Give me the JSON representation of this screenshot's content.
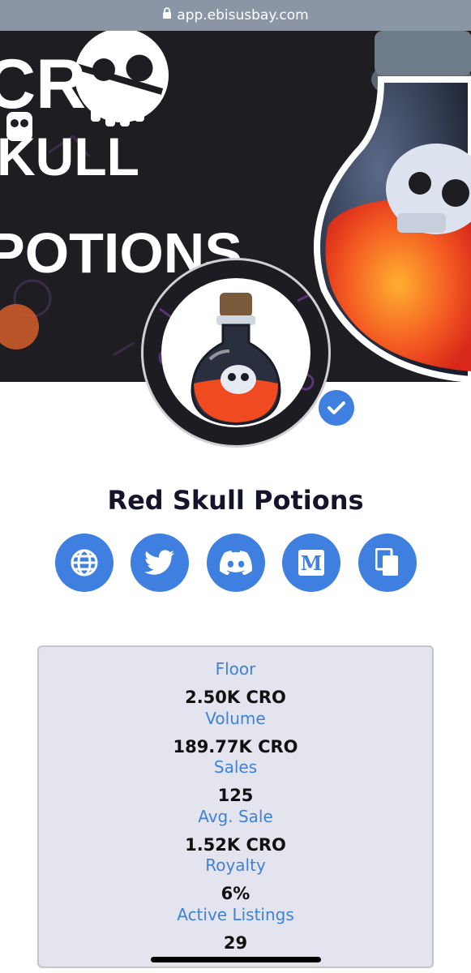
{
  "browser": {
    "url": "app.ebisusbay.com",
    "lock_icon": "lock-icon"
  },
  "banner": {
    "art_text_line1": "CR",
    "art_text_line2": "KULL",
    "art_text_line3": "POTIONS"
  },
  "collection": {
    "name": "Red Skull Potions",
    "verified_icon": "checkmark-icon"
  },
  "socials": [
    {
      "name": "website",
      "icon": "globe-icon"
    },
    {
      "name": "twitter",
      "icon": "twitter-icon"
    },
    {
      "name": "discord",
      "icon": "discord-icon"
    },
    {
      "name": "medium",
      "icon": "medium-icon",
      "glyph": "M"
    },
    {
      "name": "copy",
      "icon": "copy-icon"
    }
  ],
  "stats": [
    {
      "label": "Floor",
      "value": "2.50K CRO"
    },
    {
      "label": "Volume",
      "value": "189.77K CRO"
    },
    {
      "label": "Sales",
      "value": "125"
    },
    {
      "label": "Avg. Sale",
      "value": "1.52K CRO"
    },
    {
      "label": "Royalty",
      "value": "6%"
    },
    {
      "label": "Active Listings",
      "value": "29"
    }
  ],
  "colors": {
    "accent": "#3e7fe0",
    "stat_label": "#3e82d8",
    "card_bg": "#e4e4ee",
    "potion_liquid": "#f04a20",
    "url_bar": "#8a96a6"
  }
}
